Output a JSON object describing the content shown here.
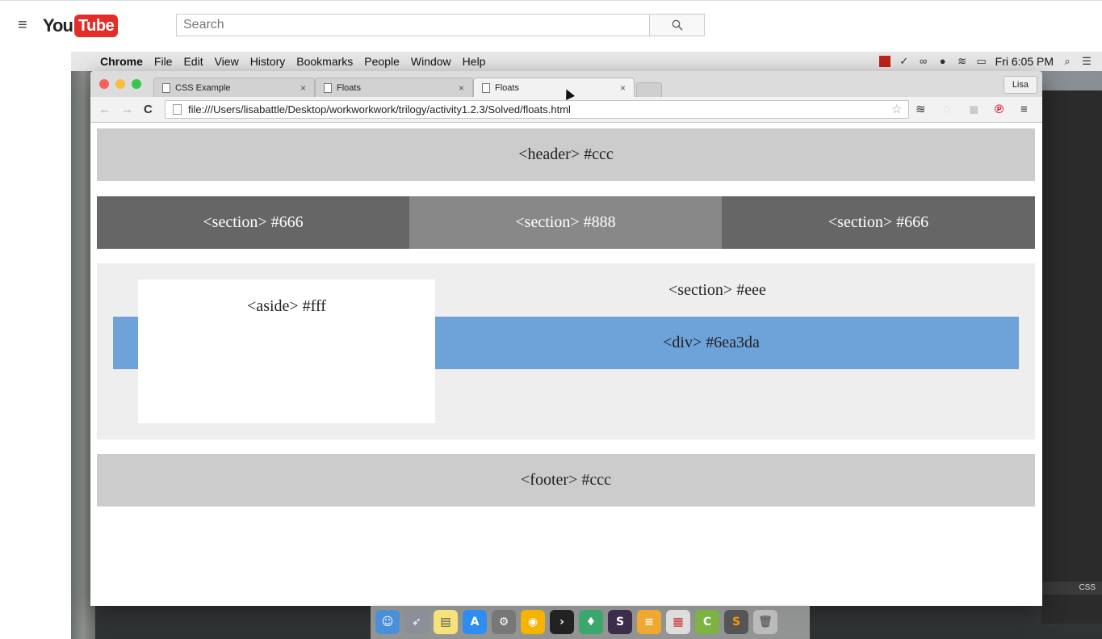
{
  "youtube": {
    "logo_you": "You",
    "logo_tube": "Tube",
    "search_placeholder": "Search"
  },
  "menubar": {
    "items": [
      "Chrome",
      "File",
      "Edit",
      "View",
      "History",
      "Bookmarks",
      "People",
      "Window",
      "Help"
    ],
    "clock": "Fri 6:05 PM"
  },
  "browser": {
    "tabs": [
      {
        "title": "CSS Example"
      },
      {
        "title": "Floats"
      },
      {
        "title": "Floats"
      }
    ],
    "profile": "Lisa",
    "url": "file:///Users/lisabattle/Desktop/workworkwork/trilogy/activity1.2.3/Solved/floats.html"
  },
  "page": {
    "header": "<header> #ccc",
    "section1": "<section> #666",
    "section2": "<section> #888",
    "section3": "<section> #666",
    "section_eee": "<section> #eee",
    "div_blue": "<div> #6ea3da",
    "aside": "<aside> #fff",
    "footer": "<footer> #ccc"
  },
  "editor_status": "CSS",
  "colors": {
    "header": "#cccccc",
    "section_dark": "#666666",
    "section_mid": "#888888",
    "section_light": "#eeeeee",
    "div_blue": "#6ea3da",
    "aside": "#ffffff",
    "youtube_red": "#e52d27"
  }
}
